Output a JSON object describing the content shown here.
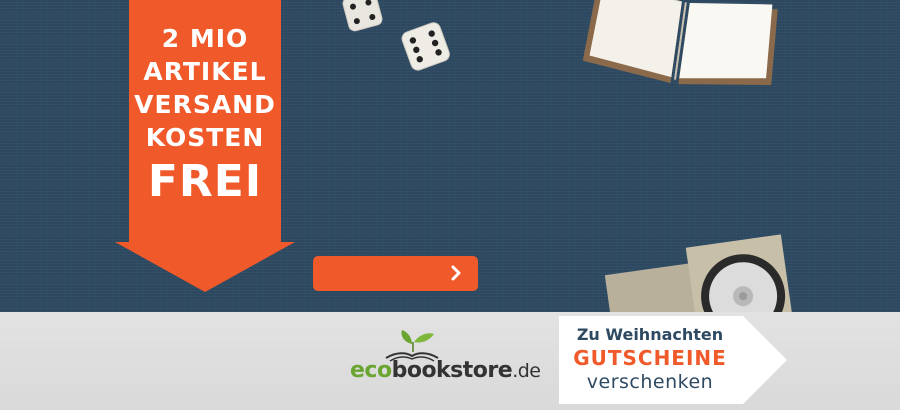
{
  "promo": {
    "lines": [
      "2 MIO",
      "ARTIKEL",
      "VERSAND",
      "KOSTEN"
    ],
    "headline": "FREI"
  },
  "cta": {
    "label": "",
    "icon": "chevron-right-icon"
  },
  "logo": {
    "part_eco": "eco",
    "part_book": "bookstore",
    "part_tld": ".de"
  },
  "voucher": {
    "line1": "Zu Weihnachten",
    "line2": "GUTSCHEINE",
    "line3": "verschenken"
  },
  "colors": {
    "background_blue": "#2e4a62",
    "accent_orange": "#f0592a",
    "footer_gray": "#dddddd",
    "logo_green": "#6aa531"
  },
  "decor": [
    "dice-icon",
    "dice-icon",
    "open-book-icon",
    "cd-case-icon"
  ]
}
